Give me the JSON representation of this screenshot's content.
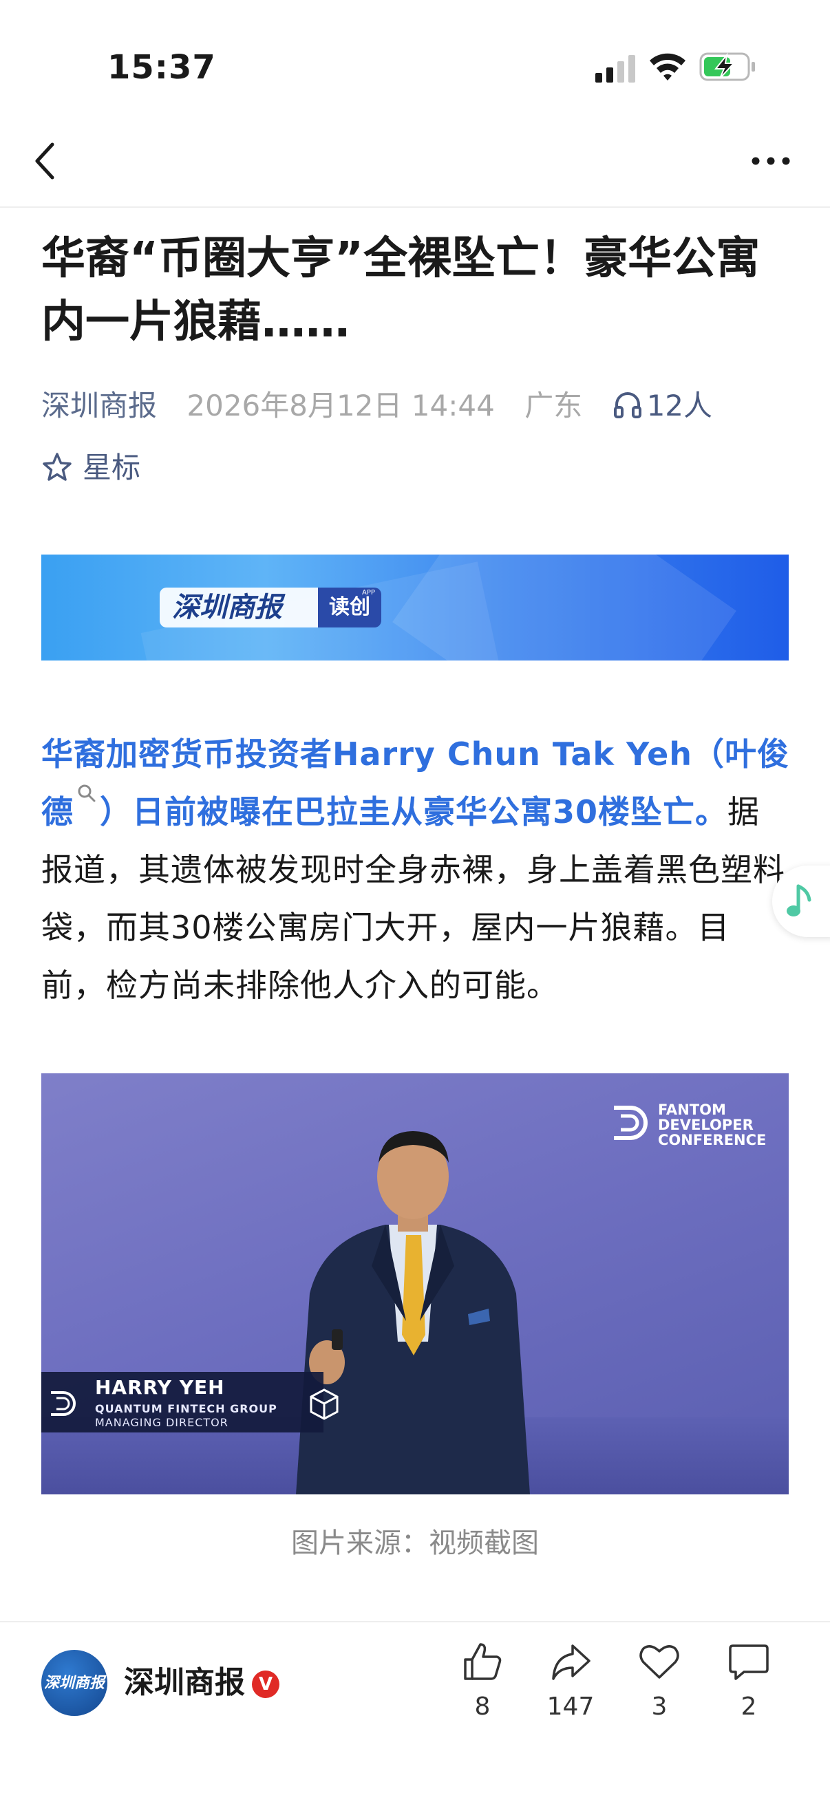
{
  "status_bar": {
    "time": "15:37"
  },
  "article": {
    "headline": "华裔“币圈大亨”全裸坠亡！豪华公寓内一片狼藉……",
    "meta": {
      "source": "深圳商报",
      "datetime": "2026年8月12日 14:44",
      "location": "广东",
      "listeners": "12人",
      "star_label": "星标"
    },
    "banner": {
      "logo_text": "深圳商报",
      "tag_text": "读创",
      "app_text": "APP"
    },
    "body": {
      "lead_part1": "华裔加密货币投资者Harry Chun Tak Yeh（叶俊德",
      "lead_part2": "）日前被曝在巴拉圭从豪华公寓30楼坠亡。",
      "rest": "据报道，其遗体被发现时全身赤裸，身上盖着黑色塑料袋，而其30楼公寓房门大开，屋内一片狼藉。目前，检方尚未排除他人介入的可能。"
    },
    "photo": {
      "conference_lines": [
        "FANTOM",
        "DEVELOPER",
        "CONFERENCE"
      ],
      "lower_third_name": "HARRY YEH",
      "lower_third_org": "QUANTUM FINTECH GROUP",
      "lower_third_role": "MANAGING DIRECTOR",
      "caption": "图片来源：视频截图"
    }
  },
  "bottom_bar": {
    "avatar_text": "深圳商报",
    "account_name": "深圳商报",
    "verified_label": "V",
    "actions": {
      "like_count": "8",
      "share_count": "147",
      "favorite_count": "3",
      "comment_count": "2"
    }
  },
  "colors": {
    "link_blue": "#2f6fde",
    "meta_gray": "#a8a8a8",
    "verified_red": "#e02a26",
    "battery_green": "#34c759"
  }
}
